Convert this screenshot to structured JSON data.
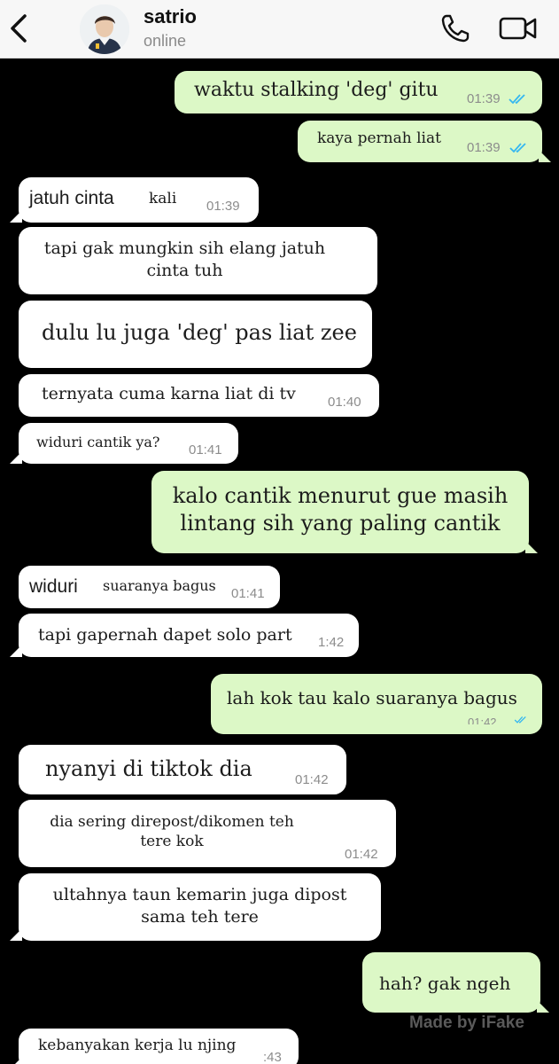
{
  "header": {
    "name": "satrio",
    "status": "online"
  },
  "messages": [
    {
      "dir": "out",
      "text": "waktu stalking 'deg' gitu",
      "time": "01:39",
      "read": true
    },
    {
      "dir": "out",
      "text": "kaya pernah liat",
      "time": "01:39",
      "read": true
    },
    {
      "dir": "in",
      "text_a": "jatuh cinta",
      "text_b": "kali",
      "time": "01:39"
    },
    {
      "dir": "in",
      "line1": "tapi gak mungkin sih elang jatuh",
      "line2": "cinta tuh"
    },
    {
      "dir": "in",
      "text": "dulu lu juga 'deg' pas liat zee"
    },
    {
      "dir": "in",
      "text": "ternyata cuma karna liat di tv",
      "time": "01:40"
    },
    {
      "dir": "in",
      "text": "widuri cantik ya?",
      "time": "01:41"
    },
    {
      "dir": "out",
      "line1": "kalo cantik menurut gue masih",
      "line2": "lintang sih yang paling cantik"
    },
    {
      "dir": "in",
      "text_a": "widuri",
      "text_b": "suaranya bagus",
      "time": "01:41"
    },
    {
      "dir": "in",
      "text": "tapi gapernah dapet solo part",
      "time": "1:42"
    },
    {
      "dir": "out",
      "text": "lah kok tau kalo suaranya bagus",
      "time": "01:42",
      "read": true
    },
    {
      "dir": "in",
      "text": "nyanyi di tiktok dia",
      "time": "01:42"
    },
    {
      "dir": "in",
      "line1": "dia sering direpost/dikomen teh",
      "line2": "tere kok",
      "time": "01:42"
    },
    {
      "dir": "in",
      "line1": "ultahnya taun kemarin juga dipost",
      "line2": "sama teh tere"
    },
    {
      "dir": "out",
      "text": "hah? gak ngeh"
    },
    {
      "dir": "in",
      "text": "kebanyakan kerja lu njing",
      "time": ":43"
    }
  ],
  "watermark": "Made by iFake",
  "colors": {
    "background": "#000000",
    "incoming_bubble": "#ffffff",
    "outgoing_bubble": "#dcf8c6",
    "read_ticks": "#34b7f1"
  },
  "icons": [
    "back-icon",
    "phone-icon",
    "video-call-icon",
    "double-check-icon"
  ]
}
